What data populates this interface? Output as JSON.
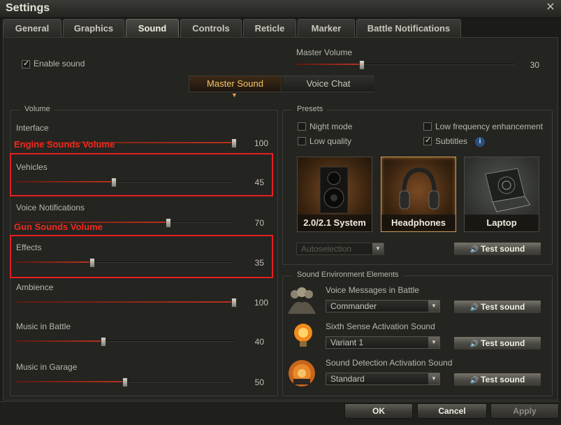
{
  "window": {
    "title": "Settings",
    "close_label": "✕"
  },
  "tabs": [
    {
      "label": "General"
    },
    {
      "label": "Graphics"
    },
    {
      "label": "Sound"
    },
    {
      "label": "Controls"
    },
    {
      "label": "Reticle"
    },
    {
      "label": "Marker"
    },
    {
      "label": "Battle Notifications"
    }
  ],
  "active_tab": "Sound",
  "enable_sound": {
    "label": "Enable sound",
    "checked": true
  },
  "master_volume": {
    "label": "Master Volume",
    "value": 30
  },
  "mode_switch": {
    "options": [
      "Master Sound",
      "Voice Chat"
    ],
    "selected": "Master Sound"
  },
  "volume": {
    "title": "Volume",
    "sliders": [
      {
        "label": "Interface",
        "value": 100
      },
      {
        "label": "Vehicles",
        "value": 45
      },
      {
        "label": "Voice Notifications",
        "value": 70
      },
      {
        "label": "Effects",
        "value": 35
      },
      {
        "label": "Ambience",
        "value": 100
      },
      {
        "label": "Music in Battle",
        "value": 40
      },
      {
        "label": "Music in Garage",
        "value": 50
      }
    ]
  },
  "annotations": {
    "engine": "Engine Sounds Volume",
    "gun": "Gun Sounds Volume"
  },
  "presets": {
    "title": "Presets",
    "options": {
      "night_mode": {
        "label": "Night mode",
        "checked": false
      },
      "low_quality": {
        "label": "Low quality",
        "checked": false
      },
      "low_freq": {
        "label": "Low frequency enhancement",
        "checked": false
      },
      "subtitles": {
        "label": "Subtitles",
        "checked": true
      }
    },
    "cards": [
      {
        "label": "2.0/2.1 System",
        "icon": "speaker-icon"
      },
      {
        "label": "Headphones",
        "icon": "headphones-icon"
      },
      {
        "label": "Laptop",
        "icon": "laptop-icon"
      }
    ],
    "selected_card": "Headphones",
    "autoselect": "Autoselection",
    "test_sound": "Test sound"
  },
  "environment": {
    "title": "Sound Environment Elements",
    "items": [
      {
        "label": "Voice Messages in Battle",
        "value": "Commander",
        "icon": "crew-icon",
        "button": "Test sound"
      },
      {
        "label": "Sixth Sense Activation Sound",
        "value": "Variant 1",
        "icon": "lightbulb-icon",
        "button": "Test sound"
      },
      {
        "label": "Sound Detection Activation Sound",
        "value": "Standard",
        "icon": "radar-icon",
        "button": "Test sound"
      }
    ]
  },
  "footer": {
    "ok": "OK",
    "cancel": "Cancel",
    "apply": "Apply"
  },
  "colors": {
    "accent_red": "#e51f1f",
    "accent_orange": "#f5c66b",
    "slider_fill": "#b8321c"
  }
}
